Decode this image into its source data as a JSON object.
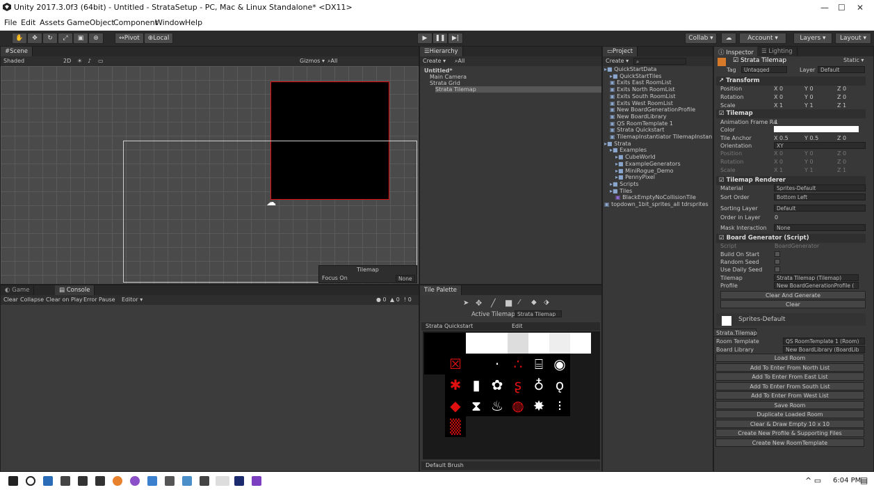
{
  "window": {
    "title": "Unity 2017.3.0f3 (64bit) - Untitled - StrataSetup - PC, Mac & Linux Standalone* <DX11>",
    "min": "—",
    "max": "☐",
    "close": "✕"
  },
  "menu": [
    "File",
    "Edit",
    "Assets",
    "GameObject",
    "Component",
    "Window",
    "Help"
  ],
  "toolbar": {
    "pivot": "Pivot",
    "local": "Local",
    "collab": "Collab ▾",
    "account": "Account ▾",
    "layers": "Layers ▾",
    "layout": "Layout ▾"
  },
  "scene": {
    "tab": "Scene",
    "shaded": "Shaded",
    "mode2d": "2D",
    "gizmos": "Gizmos ▾",
    "search": "All",
    "tilemap_label": "Tilemap",
    "focus_on": "Focus On",
    "focus_value": "None"
  },
  "game_tab": "Game",
  "console": {
    "tab": "Console",
    "clear": "Clear",
    "collapse": "Collapse",
    "clear_on_play": "Clear on Play",
    "error_pause": "Error Pause",
    "editor": "Editor ▾",
    "counts": [
      "0",
      "0",
      "0"
    ]
  },
  "hierarchy": {
    "tab": "Hierarchy",
    "create": "Create ▾",
    "search": "All",
    "items": [
      {
        "label": "Untitled*",
        "indent": 0
      },
      {
        "label": "Main Camera",
        "indent": 1
      },
      {
        "label": "Strata Grid",
        "indent": 1
      },
      {
        "label": "Strata Tilemap",
        "indent": 2
      }
    ]
  },
  "project": {
    "tab": "Project",
    "create": "Create ▾",
    "items": [
      {
        "label": "QuickStartData",
        "indent": 0
      },
      {
        "label": "QuickStartTiles",
        "indent": 1
      },
      {
        "label": "Exits East RoomList",
        "indent": 1
      },
      {
        "label": "Exits North RoomList",
        "indent": 1
      },
      {
        "label": "Exits South RoomList",
        "indent": 1
      },
      {
        "label": "Exits West RoomList",
        "indent": 1
      },
      {
        "label": "New BoardGenerationProfile",
        "indent": 1
      },
      {
        "label": "New BoardLibrary",
        "indent": 1
      },
      {
        "label": "QS RoomTemplate 1",
        "indent": 1
      },
      {
        "label": "Strata Quickstart",
        "indent": 1
      },
      {
        "label": "TilemapInstantiator TilemapInstan",
        "indent": 1
      },
      {
        "label": "Strata",
        "indent": 0
      },
      {
        "label": "Examples",
        "indent": 1
      },
      {
        "label": "CubeWorld",
        "indent": 2
      },
      {
        "label": "ExampleGenerators",
        "indent": 2
      },
      {
        "label": "MiniRogue_Demo",
        "indent": 2
      },
      {
        "label": "PennyPixel",
        "indent": 2
      },
      {
        "label": "Scripts",
        "indent": 1
      },
      {
        "label": "Tiles",
        "indent": 1
      },
      {
        "label": "BlackEmptyNoCollisionTile",
        "indent": 2
      },
      {
        "label": "topdown_1bit_sprites_all tdrsprites",
        "indent": 0
      }
    ]
  },
  "palette": {
    "tab": "Tile Palette",
    "active_tilemap_label": "Active Tilemap",
    "active_tilemap": "Strata Tilemap",
    "palette_name": "Strata Quickstart",
    "edit": "Edit",
    "brush": "Default Brush"
  },
  "inspector": {
    "tab": "Inspector",
    "lighting_tab": "Lighting",
    "object_name": "Strata Tilemap",
    "static": "Static ▾",
    "tag_label": "Tag",
    "tag": "Untagged",
    "layer_label": "Layer",
    "layer": "Default",
    "transform": {
      "title": "Transform",
      "rows": [
        {
          "label": "Position",
          "x": "0",
          "y": "0",
          "z": "0"
        },
        {
          "label": "Rotation",
          "x": "0",
          "y": "0",
          "z": "0"
        },
        {
          "label": "Scale",
          "x": "1",
          "y": "1",
          "z": "1"
        }
      ]
    },
    "tilemap": {
      "title": "Tilemap",
      "anim_label": "Animation Frame Ra",
      "anim": "1",
      "color_label": "Color",
      "anchor_label": "Tile Anchor",
      "anchor": {
        "x": "0.5",
        "y": "0.5",
        "z": "0"
      },
      "orientation_label": "Orientation",
      "orientation": "XY",
      "rows": [
        {
          "label": "Position",
          "x": "0",
          "y": "0",
          "z": "0"
        },
        {
          "label": "Rotation",
          "x": "0",
          "y": "0",
          "z": "0"
        },
        {
          "label": "Scale",
          "x": "1",
          "y": "1",
          "z": "1"
        }
      ]
    },
    "renderer": {
      "title": "Tilemap Renderer",
      "material_label": "Material",
      "material": "Sprites-Default",
      "sort_label": "Sort Order",
      "sort": "Bottom Left",
      "sorting_layer_label": "Sorting Layer",
      "sorting_layer": "Default",
      "order_label": "Order in Layer",
      "order": "0",
      "mask_label": "Mask Interaction",
      "mask": "None"
    },
    "board": {
      "title": "Board Generator (Script)",
      "script_label": "Script",
      "script": "BoardGenerator",
      "build_label": "Build On Start",
      "random_label": "Random Seed",
      "daily_label": "Use Daily Seed",
      "tilemap_label": "Tilemap",
      "tilemap": "Strata Tilemap (Tilemap)",
      "profile_label": "Profile",
      "profile": "New BoardGenerationProfile (",
      "clear_generate": "Clear And Generate",
      "clear": "Clear"
    },
    "sprites_default": "Sprites-Default",
    "strata_tab": "Strata.Tilemap",
    "room_template_label": "Room Template",
    "room_template": "QS RoomTemplate 1 (Room)",
    "board_library_label": "Board Library",
    "board_library": "New BoardLibrary (BoardLib",
    "buttons": [
      "Load Room",
      "Add To Enter From North List",
      "Add To Enter From East List",
      "Add To Enter From South List",
      "Add To Enter From West List",
      "Save Room",
      "Duplicate Loaded Room",
      "Clear & Draw Empty 10 x 10",
      "Create New Profile & Supporting Files",
      "Create New RoomTemplate"
    ]
  },
  "taskbar": {
    "time": "6:04 PM"
  },
  "colors": {
    "accent": "#3a5d8f",
    "red": "#e01010",
    "panel": "#383838"
  }
}
